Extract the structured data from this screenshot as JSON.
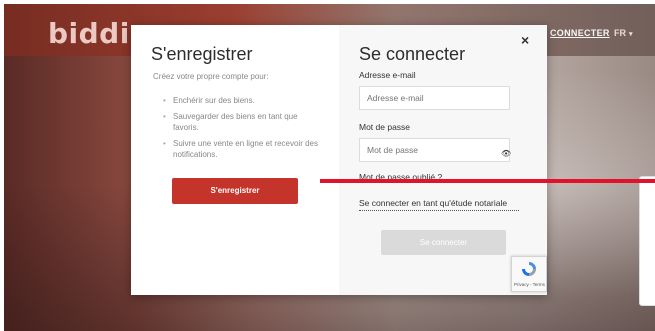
{
  "site": {
    "logo": "biddi",
    "nav_connect": "CONNECTER",
    "nav_lang": "FR",
    "brand_color": "#c5342b"
  },
  "register": {
    "title": "S'enregistrer",
    "subtitle": "Créez votre propre compte pour:",
    "benefits": [
      "Enchérir sur des biens.",
      "Sauvegarder des biens en tant que favoris.",
      "Suivre une vente en ligne et recevoir des notifications."
    ],
    "button_label": "S'enregistrer"
  },
  "login": {
    "title": "Se connecter",
    "email_label": "Adresse e-mail",
    "email_placeholder": "Adresse e-mail",
    "password_label": "Mot de passe",
    "password_placeholder": "Mot de passe",
    "forgot_password": "Mot de passe oublié ?",
    "notarial_link": "Se connecter en tant qu'étude notariale",
    "button_label": "Se connecter",
    "close_glyph": "×"
  },
  "recaptcha": {
    "footer": "Privacy - Terms"
  },
  "icons": [
    "close-icon",
    "eye-icon",
    "chevron-down-icon",
    "recaptcha-icon"
  ]
}
